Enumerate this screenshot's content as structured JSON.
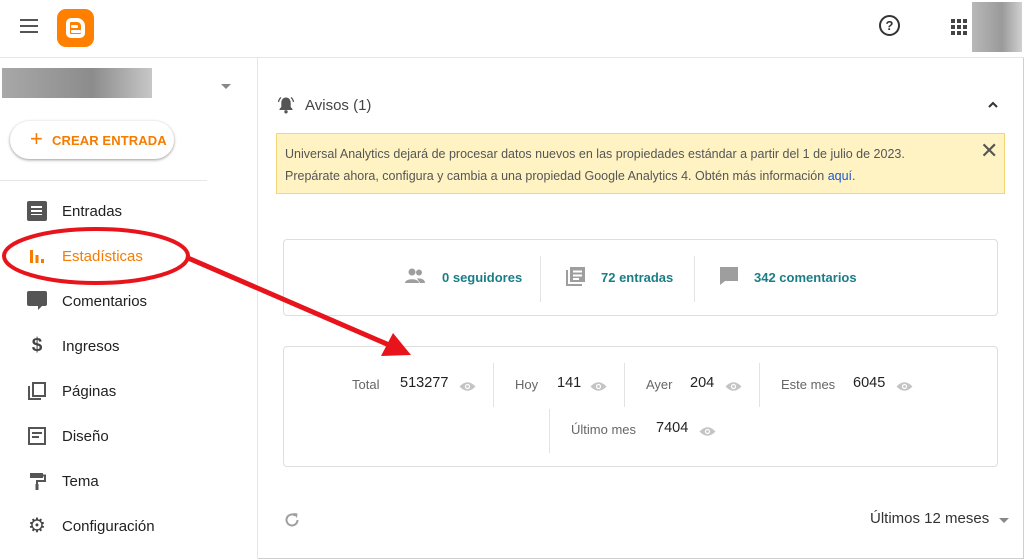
{
  "header": {
    "menu_icon": "hamburger-menu-icon",
    "logo_icon": "blogger-logo-icon",
    "help_label": "?",
    "apps_icon": "apps-grid-icon"
  },
  "sidebar": {
    "create_plus": "+",
    "create_label": "CREAR ENTRADA",
    "items": [
      {
        "label": "Entradas",
        "icon": "posts-icon"
      },
      {
        "label": "Estadísticas",
        "icon": "stats-icon",
        "active": true
      },
      {
        "label": "Comentarios",
        "icon": "comments-icon"
      },
      {
        "label": "Ingresos",
        "icon": "dollar-icon"
      },
      {
        "label": "Páginas",
        "icon": "pages-icon"
      },
      {
        "label": "Diseño",
        "icon": "layout-icon"
      },
      {
        "label": "Tema",
        "icon": "paint-roller-icon"
      },
      {
        "label": "Configuración",
        "icon": "gear-icon"
      }
    ],
    "dollar_glyph": "$",
    "gear_glyph": "⚙"
  },
  "notices": {
    "title": "Avisos (1)",
    "line1": "Universal Analytics dejará de procesar datos nuevos en las propiedades estándar a partir del 1 de julio de 2023.",
    "line2": "Prepárate ahora, configura y cambia a una propiedad Google Analytics 4. Obtén más información",
    "link": "aquí",
    "line2_end": ".",
    "close_glyph": "✕"
  },
  "summary": {
    "followers": "0 seguidores",
    "posts": "72 entradas",
    "comments": "342 comentarios"
  },
  "pageviews": {
    "total_label": "Total",
    "total_value": "513277",
    "today_label": "Hoy",
    "today_value": "141",
    "yesterday_label": "Ayer",
    "yesterday_value": "204",
    "month_label": "Este mes",
    "month_value": "6045",
    "last_month_label": "Último mes",
    "last_month_value": "7404"
  },
  "footer": {
    "period": "Últimos 12 meses"
  },
  "colors": {
    "accent": "#f57c00",
    "link_teal": "#1b7e87",
    "notice_bg": "#fff3c4",
    "annotation_red": "#e8141b"
  }
}
